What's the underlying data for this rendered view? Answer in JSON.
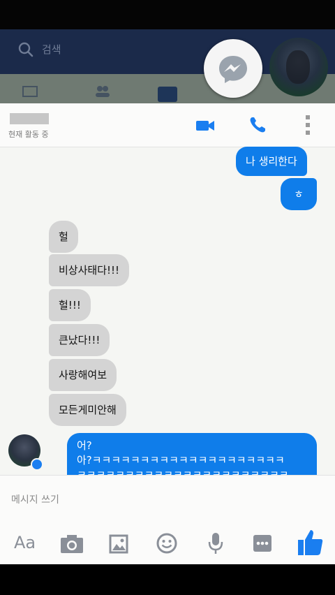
{
  "topbar": {
    "search_placeholder": "검색"
  },
  "chat_header": {
    "status": "현재 활동 중"
  },
  "messages": [
    {
      "dir": "out",
      "text": "나 생리한다"
    },
    {
      "dir": "out",
      "text": "ㅎ"
    },
    {
      "dir": "in",
      "text": "헐"
    },
    {
      "dir": "in",
      "text": "비상사태다!!!"
    },
    {
      "dir": "in",
      "text": "헐!!!"
    },
    {
      "dir": "in",
      "text": "큰났다!!!"
    },
    {
      "dir": "in",
      "text": "사랑해여보"
    },
    {
      "dir": "in",
      "text": "모든게미안해"
    },
    {
      "dir": "out",
      "text": "어?"
    },
    {
      "dir": "out",
      "text": "아?ㅋㅋㅋㅋㅋㅋㅋㅋㅋㅋㅋㅋㅋㅋㅋㅋㅋㅋㅋㅋ"
    },
    {
      "dir": "out",
      "text": "ㅋㅋㅋㅋㅋㅋㅋㅋㅋㅋㅋㅋㅋㅋㅋㅋㅋㅋㅋㅋㅋㅋ"
    }
  ],
  "composer": {
    "placeholder": "메시지 쓰기"
  },
  "toolbar": {
    "aa_label": "Aa",
    "icons": [
      "camera-icon",
      "image-icon",
      "emoji-icon",
      "microphone-icon",
      "more-options-icon",
      "like-icon"
    ]
  },
  "colors": {
    "outgoing_bubble": "#0f7dea",
    "incoming_bubble": "#d4d4d4",
    "accent": "#1a7ef0",
    "topbar": "#1b2a4a"
  }
}
